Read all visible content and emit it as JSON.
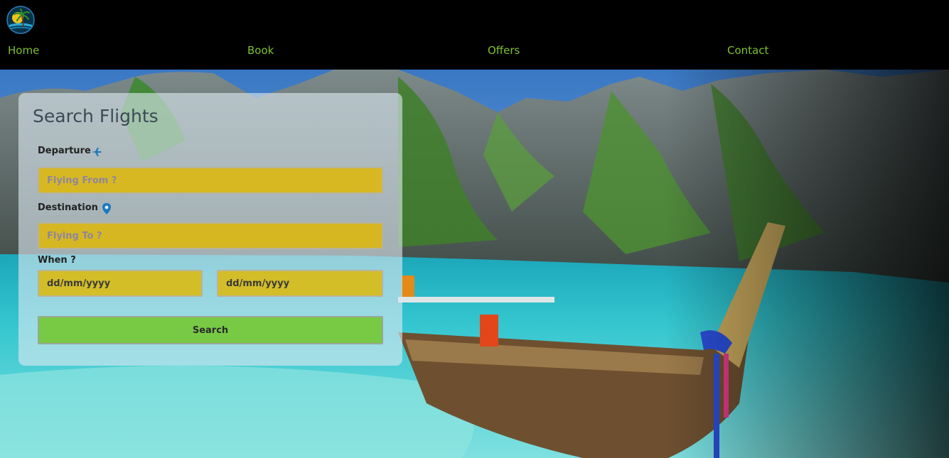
{
  "nav": {
    "items": [
      "Home",
      "Book",
      "Offers",
      "Contact"
    ]
  },
  "colors": {
    "nav_link": "#7ec02e",
    "field_fill": "#e0b800",
    "search_button": "#78ca45",
    "icon_blue": "#1a7ac0"
  },
  "search": {
    "title": "Search Flights",
    "departure_label": "Departure",
    "departure_icon": "airplane-icon",
    "departure_placeholder": "Flying From ?",
    "destination_label": "Destination",
    "destination_icon": "map-pin-icon",
    "destination_placeholder": "Flying To ?",
    "when_label": "When ?",
    "date_from": "dd/mm/yyyy",
    "date_to": "dd/mm/yyyy",
    "button_label": "Search"
  }
}
